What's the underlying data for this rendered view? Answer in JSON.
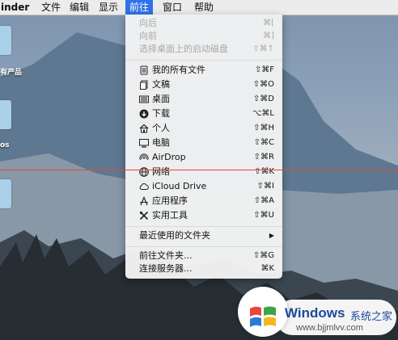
{
  "menubar": {
    "items": [
      {
        "label": "inder"
      },
      {
        "label": "文件"
      },
      {
        "label": "编辑"
      },
      {
        "label": "显示"
      },
      {
        "label": "前往"
      },
      {
        "label": "窗口"
      },
      {
        "label": "帮助"
      }
    ]
  },
  "desktop": {
    "labels": [
      "有产品",
      "os"
    ]
  },
  "go_menu": {
    "nav": [
      {
        "label": "向后",
        "shortcut": "⌘[",
        "enabled": false
      },
      {
        "label": "向前",
        "shortcut": "⌘]",
        "enabled": false
      },
      {
        "label": "选择桌面上的启动磁盘",
        "shortcut": "⇧⌘↑",
        "enabled": false
      }
    ],
    "places": [
      {
        "label": "我的所有文件",
        "shortcut": "⇧⌘F",
        "icon": "all-my-files-icon"
      },
      {
        "label": "文稿",
        "shortcut": "⇧⌘O",
        "icon": "documents-icon"
      },
      {
        "label": "桌面",
        "shortcut": "⇧⌘D",
        "icon": "desktop-icon"
      },
      {
        "label": "下载",
        "shortcut": "⌥⌘L",
        "icon": "download-icon"
      },
      {
        "label": "个人",
        "shortcut": "⇧⌘H",
        "icon": "home-icon"
      },
      {
        "label": "电脑",
        "shortcut": "⇧⌘C",
        "icon": "computer-icon"
      },
      {
        "label": "AirDrop",
        "shortcut": "⇧⌘R",
        "icon": "airdrop-icon"
      },
      {
        "label": "网络",
        "shortcut": "⇧⌘K",
        "icon": "network-icon"
      },
      {
        "label": "iCloud Drive",
        "shortcut": "⇧⌘I",
        "icon": "cloud-icon"
      },
      {
        "label": "应用程序",
        "shortcut": "⇧⌘A",
        "icon": "applications-icon"
      },
      {
        "label": "实用工具",
        "shortcut": "⇧⌘U",
        "icon": "utilities-icon"
      }
    ],
    "recent": {
      "label": "最近使用的文件夹",
      "submenu_indicator": "▶"
    },
    "actions": [
      {
        "label": "前往文件夹...",
        "shortcut": "⇧⌘G"
      },
      {
        "label": "连接服务器...",
        "shortcut": "⌘K"
      }
    ]
  },
  "watermark": {
    "title": "Windows",
    "subtitle": "系统之家",
    "url": "www.bjjmlvv.com"
  },
  "colors": {
    "menu_highlight": "#2f73e8",
    "annotation_line": "#e8453c",
    "watermark_blue": "#1b4a9a"
  }
}
